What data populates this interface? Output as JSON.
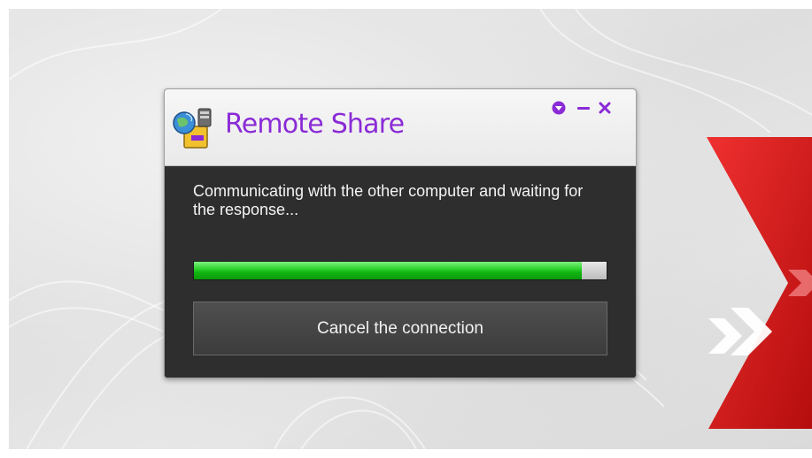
{
  "dialog": {
    "title": "Remote Share",
    "message": "Communicating with the other computer and waiting for the response...",
    "progress_fraction": 0.94,
    "cancel_label": "Cancel the connection",
    "icons": {
      "app": "remote-share-app-icon",
      "menu": "dropdown-menu-icon",
      "minimize": "minimize-icon",
      "close": "close-icon"
    }
  },
  "colors": {
    "title": "#8a2bd6",
    "window_controls": "#8a2bd6",
    "panel_background": "#2e2e2e",
    "progress_fill": "#1fc81f",
    "brand_red": "#d61a1a"
  }
}
